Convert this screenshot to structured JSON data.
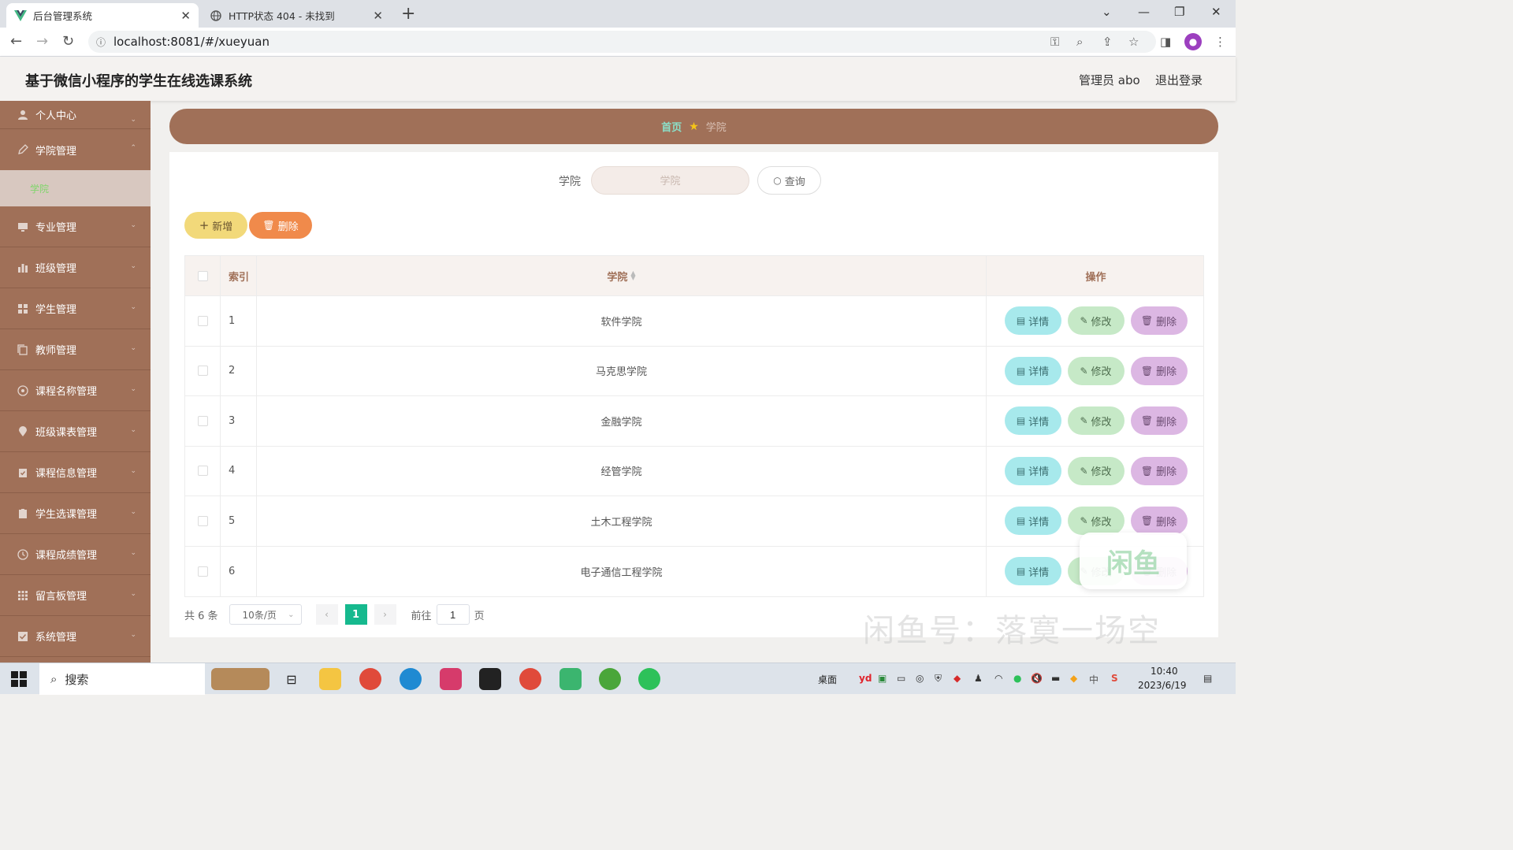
{
  "browser": {
    "tabs": [
      {
        "title": "后台管理系统",
        "active": true
      },
      {
        "title": "HTTP状态 404 - 未找到",
        "active": false
      }
    ],
    "url": "localhost:8081/#/xueyuan"
  },
  "header": {
    "title": "基于微信小程序的学生在线选课系统",
    "user": "管理员 abo",
    "logout": "退出登录"
  },
  "sidebar": {
    "items": [
      {
        "label": "个人中心"
      },
      {
        "label": "学院管理",
        "sub": "学院"
      },
      {
        "label": "专业管理"
      },
      {
        "label": "班级管理"
      },
      {
        "label": "学生管理"
      },
      {
        "label": "教师管理"
      },
      {
        "label": "课程名称管理"
      },
      {
        "label": "班级课表管理"
      },
      {
        "label": "课程信息管理"
      },
      {
        "label": "学生选课管理"
      },
      {
        "label": "课程成绩管理"
      },
      {
        "label": "留言板管理"
      },
      {
        "label": "系统管理"
      }
    ]
  },
  "breadcrumb": {
    "home": "首页",
    "current": "学院"
  },
  "search": {
    "label": "学院",
    "placeholder": "学院",
    "button": "查询"
  },
  "actions": {
    "add": "新增",
    "delete": "删除"
  },
  "table": {
    "headers": {
      "index": "索引",
      "name": "学院",
      "ops": "操作"
    },
    "op_labels": {
      "detail": "详情",
      "edit": "修改",
      "delete": "删除"
    },
    "rows": [
      {
        "index": "1",
        "name": "软件学院"
      },
      {
        "index": "2",
        "name": "马克思学院"
      },
      {
        "index": "3",
        "name": "金融学院"
      },
      {
        "index": "4",
        "name": "经管学院"
      },
      {
        "index": "5",
        "name": "土木工程学院"
      },
      {
        "index": "6",
        "name": "电子通信工程学院"
      }
    ]
  },
  "pagination": {
    "total": "共 6 条",
    "page_size": "10条/页",
    "current": "1",
    "goto_label": "前往",
    "goto_value": "1",
    "page_unit": "页"
  },
  "watermark": {
    "text": "闲鱼号：落寞一场空",
    "badge": "闲鱼"
  },
  "taskbar": {
    "search": "搜索",
    "desktop": "桌面",
    "time": "10:40",
    "date": "2023/6/19",
    "ime": "中"
  },
  "colors": {
    "sidebar": "#a07058",
    "primary_page": "#16b98e",
    "detail": "#a7e9ec",
    "edit": "#c6e9c7",
    "delete": "#dcb7e3"
  }
}
